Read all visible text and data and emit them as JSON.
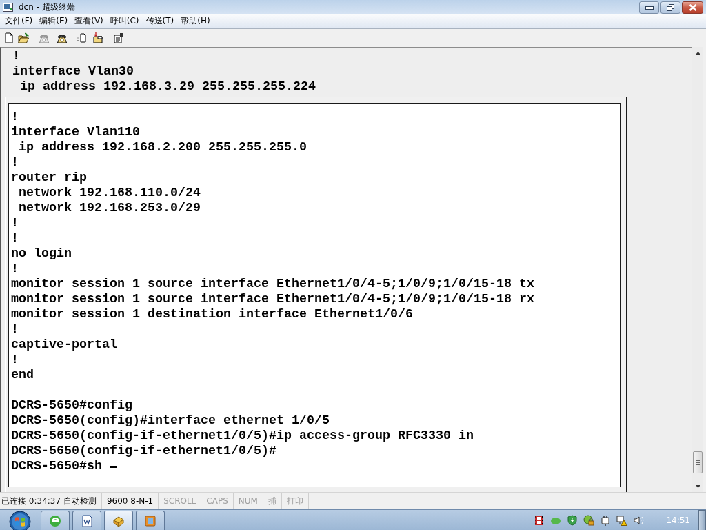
{
  "window": {
    "title": "dcn - 超级终端"
  },
  "menu": [
    "文件(F)",
    "编辑(E)",
    "查看(V)",
    "呼叫(C)",
    "传送(T)",
    "帮助(H)"
  ],
  "toolbar": [
    {
      "kind": "new",
      "disabled": false
    },
    {
      "kind": "open",
      "disabled": false
    },
    {
      "kind": "call",
      "disabled": true
    },
    {
      "kind": "hangup",
      "disabled": false
    },
    {
      "kind": "send",
      "disabled": false
    },
    {
      "kind": "receive",
      "disabled": false
    },
    {
      "kind": "properties",
      "disabled": false
    }
  ],
  "terminal": {
    "lines": [
      "!",
      "interface Vlan30",
      " ip address 192.168.3.29 255.255.255.224"
    ],
    "panel": {
      "blocks": [
        [
          "!",
          "interface Vlan110",
          " ip address 192.168.2.200 255.255.255.0",
          "!",
          "router rip",
          " network 192.168.110.0/24",
          " network 192.168.253.0/29",
          "!",
          "!",
          "no login",
          "!",
          "monitor session 1 source interface Ethernet1/0/4-5;1/0/9;1/0/15-18 tx",
          "monitor session 1 source interface Ethernet1/0/4-5;1/0/9;1/0/15-18 rx",
          "monitor session 1 destination interface Ethernet1/0/6",
          "!",
          "captive-portal",
          "!",
          "end"
        ],
        [
          "DCRS-5650#config",
          "DCRS-5650(config)#interface ethernet 1/0/5",
          "DCRS-5650(config-if-ethernet1/0/5)#ip access-group RFC3330 in",
          "DCRS-5650(config-if-ethernet1/0/5)#",
          "DCRS-5650#sh "
        ]
      ]
    },
    "cursor_visible": true
  },
  "status_bar": [
    {
      "text": "已连接 0:34:37 自动检测",
      "disabled": false
    },
    {
      "text": "9600 8-N-1",
      "disabled": false
    },
    {
      "text": "SCROLL",
      "disabled": true
    },
    {
      "text": "CAPS",
      "disabled": true
    },
    {
      "text": "NUM",
      "disabled": true
    },
    {
      "text": "捕",
      "disabled": true
    },
    {
      "text": "打印",
      "disabled": true
    }
  ],
  "taskbar": {
    "apps": [
      {
        "kind": "browser",
        "selected": false
      },
      {
        "kind": "document",
        "selected": false
      },
      {
        "kind": "terminal",
        "selected": true
      },
      {
        "kind": "window",
        "selected": false
      }
    ],
    "clock": "14:51"
  }
}
